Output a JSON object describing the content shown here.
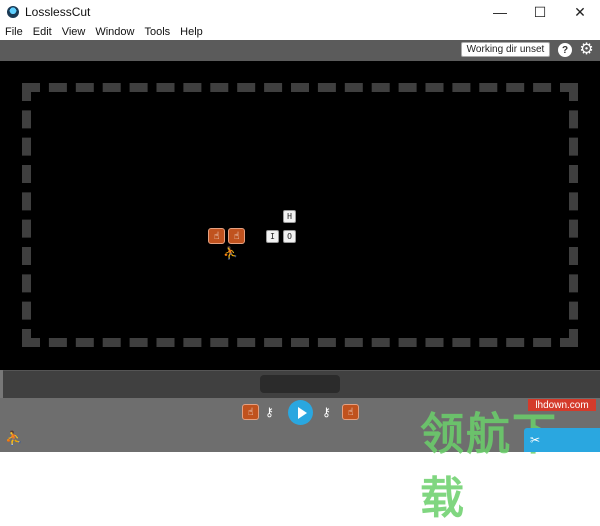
{
  "window": {
    "title": "LosslessCut",
    "controls": {
      "minimize": "—",
      "maximize": "☐",
      "close": "✕"
    }
  },
  "menu": [
    "File",
    "Edit",
    "View",
    "Window",
    "Tools",
    "Help"
  ],
  "topbar": {
    "working_dir": "Working dir unset",
    "help_label": "?",
    "settings_icon": "⚙"
  },
  "player": {
    "keys": {
      "h": "H",
      "i": "I",
      "o": "O"
    },
    "orange_glyph": "☝",
    "person_glyph": "⛹"
  },
  "controls": {
    "key_glyph": "⚷",
    "export_glyph": "✂"
  },
  "watermark": {
    "text": "领航下载",
    "url": "lhdown.com"
  },
  "colors": {
    "accent": "#2aa7e0",
    "orange": "#c0521e",
    "topbar": "#5b5b5b",
    "controls": "#6e6e6e"
  }
}
